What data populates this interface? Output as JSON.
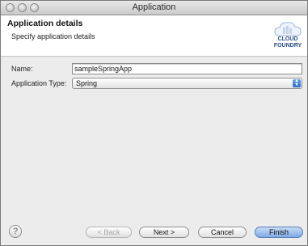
{
  "window": {
    "title": "Application"
  },
  "banner": {
    "title": "Application details",
    "subtitle": "Specify application details",
    "logo_line1": "CLOUD",
    "logo_line2": "FOUNDRY"
  },
  "form": {
    "name_label": "Name:",
    "name_value": "sampleSpringApp",
    "type_label": "Application Type:",
    "type_value": "Spring"
  },
  "footer": {
    "help_glyph": "?",
    "back_label": "< Back",
    "next_label": "Next >",
    "cancel_label": "Cancel",
    "finish_label": "Finish"
  },
  "colors": {
    "accent": "#5b8fd9",
    "logo_text": "#2a4c8a"
  }
}
